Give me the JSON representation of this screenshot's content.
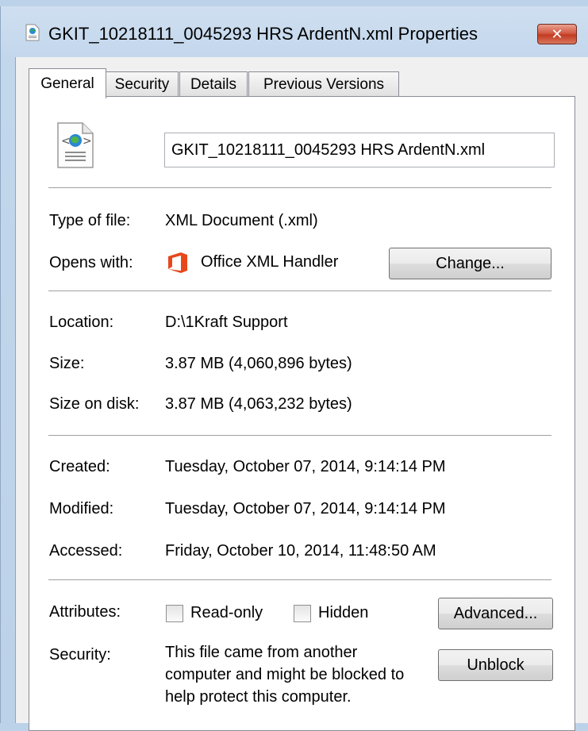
{
  "window": {
    "title": "GKIT_10218111_0045293 HRS ArdentN.xml Properties",
    "close_label": "✕"
  },
  "tabs": [
    {
      "label": "General",
      "active": true
    },
    {
      "label": "Security",
      "active": false
    },
    {
      "label": "Details",
      "active": false
    },
    {
      "label": "Previous Versions",
      "active": false
    }
  ],
  "file": {
    "name": "GKIT_10218111_0045293 HRS ArdentN.xml",
    "icon": "xml-document-icon"
  },
  "details": {
    "type_label": "Type of file:",
    "type_value": "XML Document (.xml)",
    "opens_label": "Opens with:",
    "opens_value": "Office XML Handler",
    "opens_icon": "office-logo-icon",
    "change_label": "Change...",
    "location_label": "Location:",
    "location_value": "D:\\1Kraft Support",
    "size_label": "Size:",
    "size_value": "3.87 MB (4,060,896 bytes)",
    "size_disk_label": "Size on disk:",
    "size_disk_value": "3.87 MB (4,063,232 bytes)",
    "created_label": "Created:",
    "created_value": "Tuesday, October 07, 2014, 9:14:14 PM",
    "modified_label": "Modified:",
    "modified_value": "Tuesday, October 07, 2014, 9:14:14 PM",
    "accessed_label": "Accessed:",
    "accessed_value": "Friday, October 10, 2014, 11:48:50 AM"
  },
  "attributes": {
    "label": "Attributes:",
    "readonly_label": "Read-only",
    "readonly_checked": false,
    "hidden_label": "Hidden",
    "hidden_checked": false,
    "advanced_label": "Advanced..."
  },
  "security": {
    "label": "Security:",
    "text": "This file came from another computer and might be blocked to help protect this computer.",
    "unblock_label": "Unblock"
  },
  "colors": {
    "close_button": "#c23b22",
    "office_logo": "#e8471c",
    "title_bar": "#c2d6ec"
  }
}
